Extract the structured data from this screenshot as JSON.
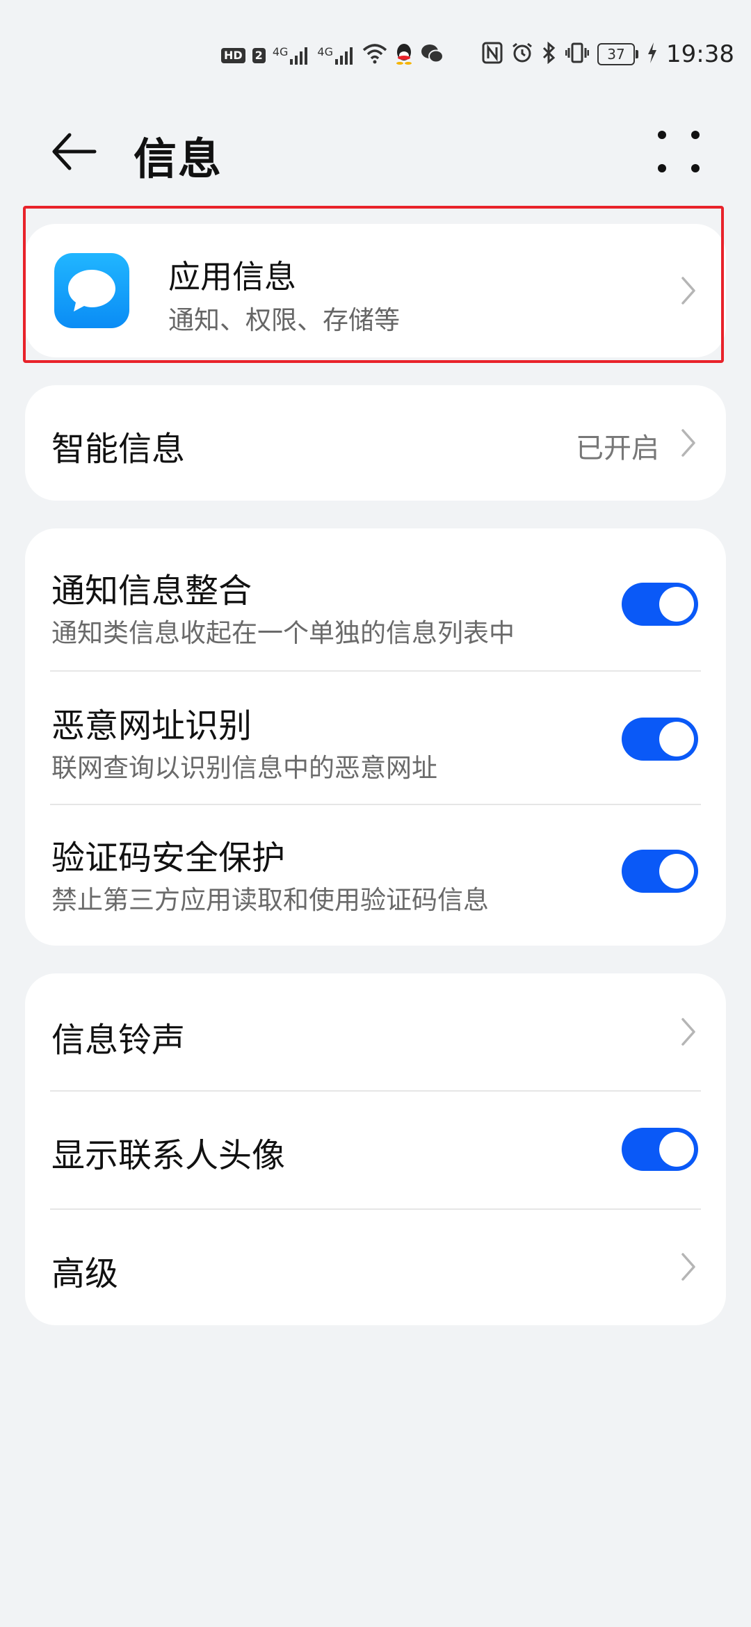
{
  "status_bar": {
    "time": "19:38",
    "battery": "37",
    "hd_badge": "HD",
    "sim_badge": "2",
    "net1": "4G",
    "net2": "4G",
    "icons_left": [
      "hd-icon",
      "signal-4g-icon",
      "signal-4g-icon",
      "wifi-icon",
      "qq-icon",
      "wechat-icon"
    ],
    "icons_right": [
      "nfc-icon",
      "alarm-icon",
      "bluetooth-icon",
      "vibrate-icon",
      "battery-icon",
      "charging-icon"
    ]
  },
  "header": {
    "title": "信息"
  },
  "app_info": {
    "label": "应用信息",
    "sub": "通知、权限、存储等"
  },
  "smart": {
    "label": "智能信息",
    "value": "已开启"
  },
  "toggles_group": [
    {
      "label": "通知信息整合",
      "sub": "通知类信息收起在一个单独的信息列表中",
      "on": true
    },
    {
      "label": "恶意网址识别",
      "sub": "联网查询以识别信息中的恶意网址",
      "on": true
    },
    {
      "label": "验证码安全保护",
      "sub": "禁止第三方应用读取和使用验证码信息",
      "on": true
    }
  ],
  "misc_group": {
    "ringtone_label": "信息铃声",
    "avatar_label": "显示联系人头像",
    "avatar_on": true,
    "advanced_label": "高级"
  },
  "colors": {
    "accent": "#0a59f7",
    "highlight": "#e8222a",
    "background": "#f1f3f5"
  }
}
